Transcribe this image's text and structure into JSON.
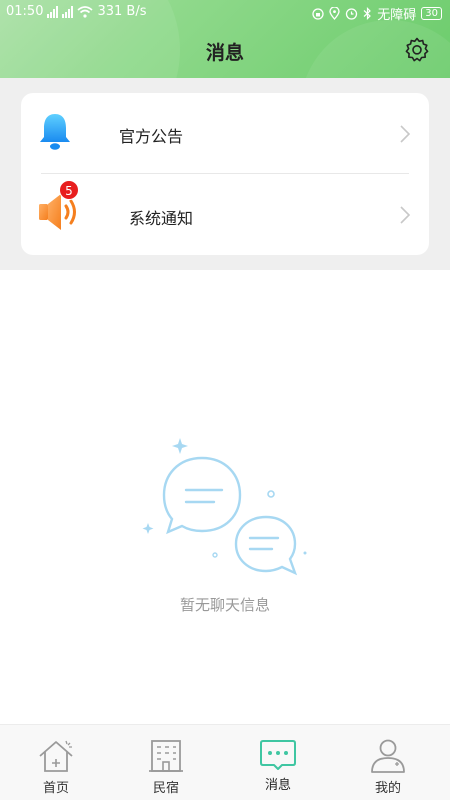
{
  "status_bar": {
    "time": "01:50",
    "net_speed": "331 B/s",
    "carrier": "无障碍",
    "battery": "30"
  },
  "header": {
    "title": "消息"
  },
  "notices": [
    {
      "label": "官方公告",
      "icon": "bell-icon"
    },
    {
      "label": "系统通知",
      "icon": "speaker-icon",
      "badge": "5"
    }
  ],
  "empty_state": {
    "text": "暂无聊天信息"
  },
  "tabbar": {
    "items": [
      {
        "label": "首页",
        "icon": "home-icon"
      },
      {
        "label": "民宿",
        "icon": "building-icon"
      },
      {
        "label": "消息",
        "icon": "message-icon",
        "active": true
      },
      {
        "label": "我的",
        "icon": "profile-icon"
      }
    ]
  },
  "colors": {
    "accent": "#3fc6a2",
    "header_green": "#7ed47b",
    "badge_red": "#e81e1e"
  }
}
